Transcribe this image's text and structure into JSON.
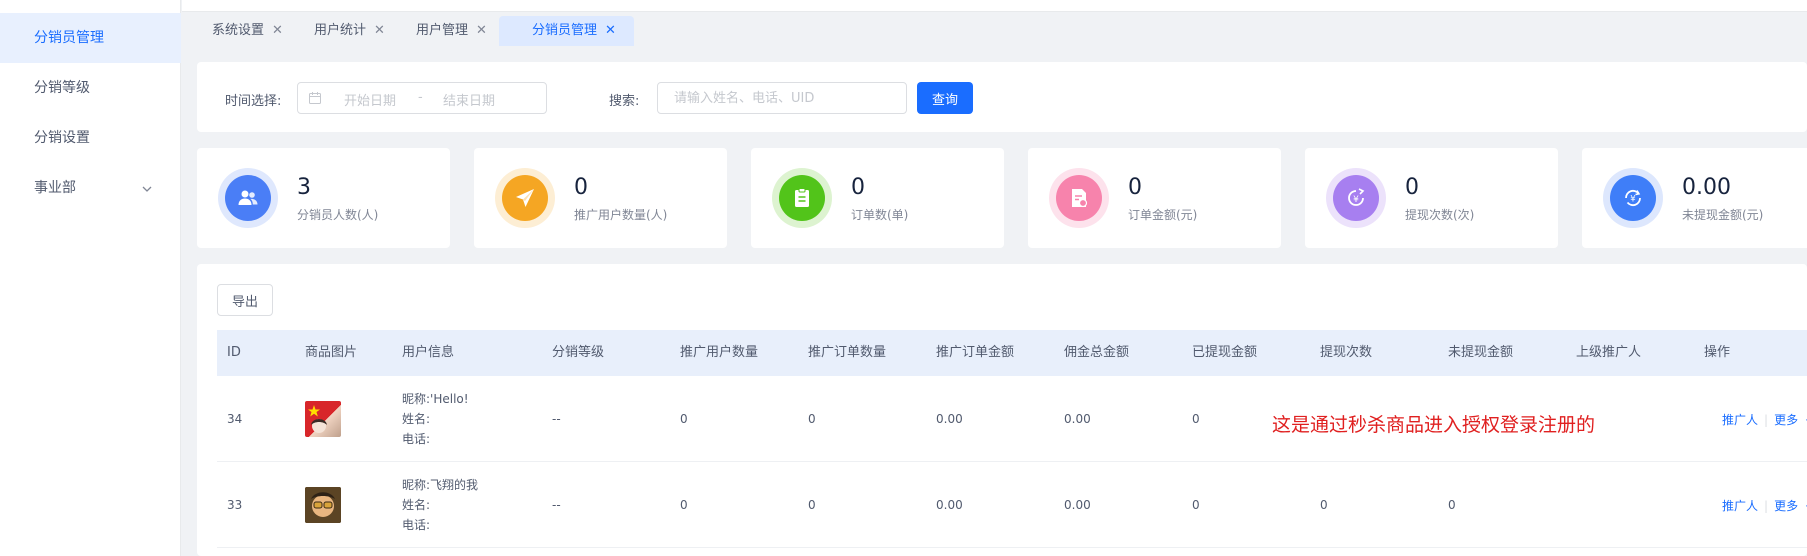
{
  "sidebar": {
    "items": [
      {
        "label": "分销员管理",
        "active": true
      },
      {
        "label": "分销等级"
      },
      {
        "label": "分销设置"
      },
      {
        "label": "事业部",
        "icon": "chevron-down-icon"
      }
    ]
  },
  "tabs": [
    {
      "label": "系统设置"
    },
    {
      "label": "用户统计"
    },
    {
      "label": "用户管理"
    },
    {
      "label": "分销员管理",
      "active": true
    }
  ],
  "tab_close_glyph": "✕",
  "filter": {
    "time_label": "时间选择:",
    "start_placeholder": "开始日期",
    "range_separator": "-",
    "end_placeholder": "结束日期",
    "search_label": "搜索:",
    "search_placeholder": "请输入姓名、电话、UID",
    "query_button": "查询"
  },
  "stats": [
    {
      "value": "3",
      "caption": "分销员人数(人)",
      "icon": "users-icon",
      "color": "#4a7ef6"
    },
    {
      "value": "0",
      "caption": "推广用户数量(人)",
      "icon": "paper-plane-icon",
      "color": "#f5a623"
    },
    {
      "value": "0",
      "caption": "订单数(单)",
      "icon": "clipboard-icon",
      "color": "#52c41a"
    },
    {
      "value": "0",
      "caption": "订单金额(元)",
      "icon": "invoice-icon",
      "color": "#f783ac"
    },
    {
      "value": "0",
      "caption": "提现次数(次)",
      "icon": "withdraw-yen-icon",
      "color": "#a77ff0"
    },
    {
      "value": "0.00",
      "caption": "未提现金额(元)",
      "icon": "refresh-yen-icon",
      "color": "#3f7ef8"
    }
  ],
  "table": {
    "export_button": "导出",
    "columns": [
      "ID",
      "商品图片",
      "用户信息",
      "分销等级",
      "推广用户数量",
      "推广订单数量",
      "推广订单金额",
      "佣金总金额",
      "已提现金额",
      "提现次数",
      "未提现金额",
      "上级推广人",
      "操作"
    ],
    "rows": [
      {
        "id": "34",
        "nickname": "昵称:'Hello!",
        "name": "姓名:",
        "phone": "电话:",
        "level": "--",
        "promo_users": "0",
        "promo_orders": "0",
        "promo_amount": "0.00",
        "commission_total": "0.00",
        "withdrawn": "0",
        "withdraw_count": "",
        "unwithdrawn": "",
        "superior": "",
        "action_promoter": "推广人",
        "action_more": "更多"
      },
      {
        "id": "33",
        "nickname": "昵称:飞翔的我",
        "name": "姓名:",
        "phone": "电话:",
        "level": "--",
        "promo_users": "0",
        "promo_orders": "0",
        "promo_amount": "0.00",
        "commission_total": "0.00",
        "withdrawn": "0",
        "withdraw_count": "0",
        "unwithdrawn": "0",
        "superior": "",
        "action_promoter": "推广人",
        "action_more": "更多"
      }
    ]
  },
  "annotation": "这是通过秒杀商品进入授权登录注册的",
  "colors": {
    "primary": "#1a6dff",
    "annotation": "#e02020"
  }
}
